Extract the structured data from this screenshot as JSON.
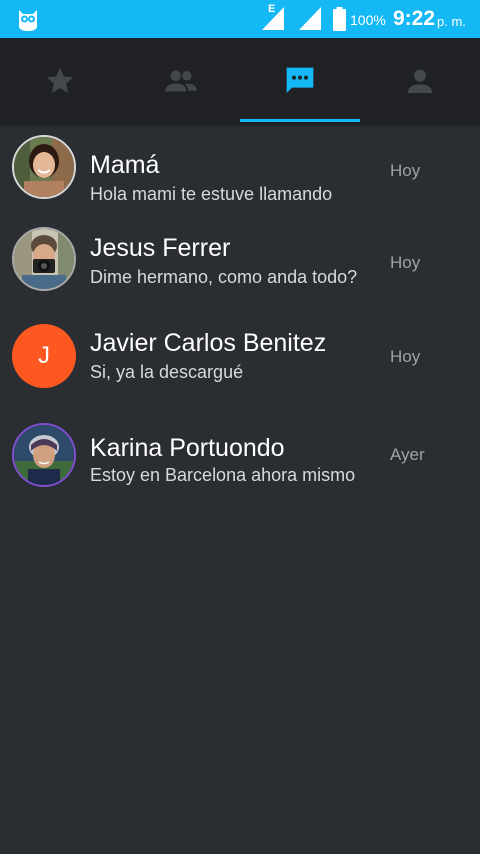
{
  "status_bar": {
    "battery_percent": "100%",
    "time": "9:22",
    "ampm": "p. m.",
    "network_type": "E",
    "icons": [
      "owl-app-icon",
      "signal-icon",
      "battery-icon"
    ]
  },
  "tabs": [
    {
      "icon": "star-icon",
      "selected": false
    },
    {
      "icon": "group-icon",
      "selected": false
    },
    {
      "icon": "chat-icon",
      "selected": true
    },
    {
      "icon": "person-icon",
      "selected": false
    }
  ],
  "conversations": [
    {
      "name": "Mamá",
      "snippet": "Hola mami te estuve llamando",
      "time": "Hoy"
    },
    {
      "name": "Jesus Ferrer",
      "snippet": "Dime hermano, como anda todo?",
      "time": "Hoy"
    },
    {
      "name": "Javier Carlos Benitez",
      "snippet": "Si, ya la descargué",
      "time": "Hoy",
      "initial": "J"
    },
    {
      "name": "Karina Portuondo",
      "snippet": "Estoy en Barcelona ahora mismo",
      "time": "Ayer"
    }
  ],
  "colors": {
    "accent": "#13b8f5",
    "background": "#2a2d31",
    "tab_bar": "#1f2124",
    "letter_avatar": "#fe5722"
  }
}
